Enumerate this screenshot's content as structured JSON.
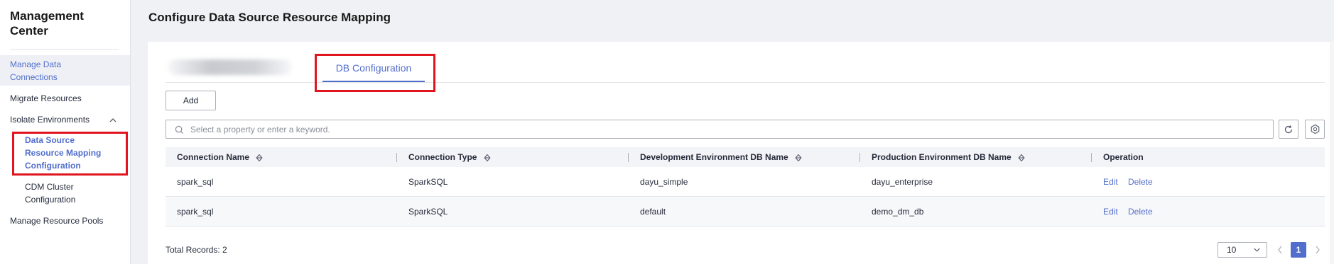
{
  "sidebar": {
    "title": "Management Center",
    "items": [
      {
        "label": "Manage Data Connections"
      },
      {
        "label": "Migrate Resources"
      },
      {
        "label": "Isolate Environments"
      },
      {
        "label": "Data Source Resource Mapping Configuration"
      },
      {
        "label": "CDM Cluster Configuration"
      },
      {
        "label": "Manage Resource Pools"
      }
    ]
  },
  "header": {
    "title": "Configure Data Source Resource Mapping"
  },
  "tabs": [
    {
      "label": "DB Configuration",
      "active": true
    }
  ],
  "toolbar": {
    "add_label": "Add"
  },
  "search": {
    "placeholder": "Select a property or enter a keyword."
  },
  "table": {
    "columns": [
      "Connection Name",
      "Connection Type",
      "Development Environment DB Name",
      "Production Environment DB Name",
      "Operation"
    ],
    "rows": [
      {
        "connection_name": "spark_sql",
        "connection_type": "SparkSQL",
        "dev_db": "dayu_simple",
        "prod_db": "dayu_enterprise",
        "edit": "Edit",
        "delete": "Delete"
      },
      {
        "connection_name": "spark_sql",
        "connection_type": "SparkSQL",
        "dev_db": "default",
        "prod_db": "demo_dm_db",
        "edit": "Edit",
        "delete": "Delete"
      }
    ]
  },
  "pagination": {
    "total_label": "Total Records: 2",
    "page_size": "10",
    "current_page": "1"
  },
  "colors": {
    "accent": "#526ecc",
    "highlight_box": "#e0151f"
  },
  "icons": [
    "chevron-up-icon",
    "search-icon",
    "refresh-icon",
    "settings-icon",
    "sort-icon",
    "chevron-down-icon",
    "chevron-left-icon",
    "chevron-right-icon"
  ]
}
